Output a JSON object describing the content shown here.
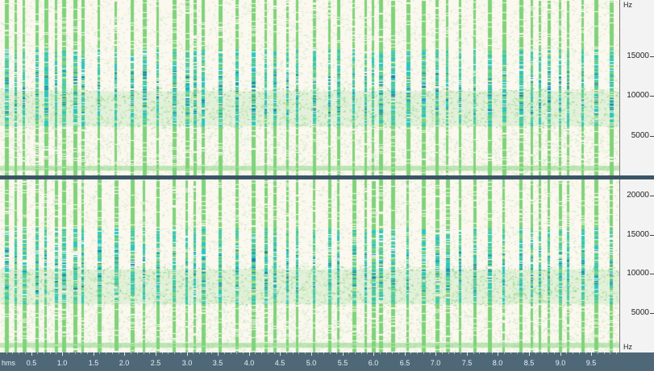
{
  "spectrogram": {
    "channels": [
      {
        "id": "channel-1",
        "scale_unit": "Hz",
        "freq_labels": [
          "15000",
          "10000",
          "5000"
        ],
        "freq_values": [
          15000,
          10000,
          5000
        ]
      },
      {
        "id": "channel-2",
        "scale_unit": "Hz",
        "freq_labels": [
          "20000",
          "15000",
          "10000",
          "5000"
        ],
        "freq_values": [
          20000,
          15000,
          10000,
          5000
        ]
      }
    ],
    "freq_max": 22050,
    "time_ruler": {
      "unit": "hms",
      "labels": [
        "0.5",
        "1.0",
        "1.5",
        "2.0",
        "2.5",
        "3.0",
        "3.5",
        "4.0",
        "4.5",
        "5.0",
        "5.5",
        "6.0",
        "6.5",
        "7.0",
        "7.5",
        "8.0",
        "8.5",
        "9.0",
        "9.5"
      ],
      "values": [
        0.5,
        1.0,
        1.5,
        2.0,
        2.5,
        3.0,
        3.5,
        4.0,
        4.5,
        5.0,
        5.5,
        6.0,
        6.5,
        7.0,
        7.5,
        8.0,
        8.5,
        9.0,
        9.5
      ],
      "duration_seconds": 9.95
    },
    "colors": {
      "background": "#fbf8ef",
      "low_energy": "#c9e6c0",
      "mid_energy": "#7fd37a",
      "high_energy": "#2bc6c0",
      "peak_energy": "#1f7fa8",
      "ruler_bg": "#4e6878"
    }
  }
}
